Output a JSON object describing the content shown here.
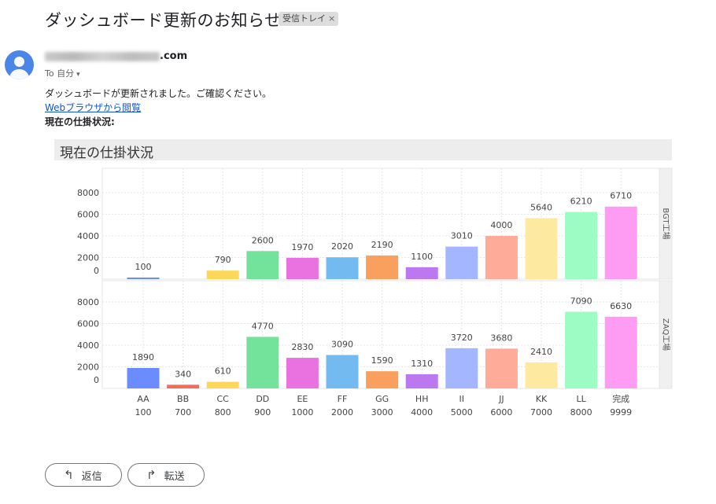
{
  "email": {
    "subject": "ダッシュボード更新のお知らせ",
    "label": "受信トレイ",
    "label_close": "×",
    "sender_domain": ".com",
    "to": "To 自分",
    "to_caret": "▾",
    "body_line1": "ダッシュボードが更新されました。ご確認ください。",
    "link_text": "Webブラウザから閲覧",
    "bold_line": "現在の仕掛状況:"
  },
  "actions": {
    "reply_label": "返信",
    "forward_label": "転送",
    "reply_icon": "↰",
    "forward_icon": "↱"
  },
  "chart_title": "現在の仕掛状況",
  "chart_data": {
    "type": "bar",
    "title": "現在の仕掛状況",
    "categories": [
      "AA",
      "BB",
      "CC",
      "DD",
      "EE",
      "FF",
      "GG",
      "HH",
      "II",
      "JJ",
      "KK",
      "LL",
      "完成"
    ],
    "category_codes": [
      "100",
      "700",
      "800",
      "900",
      "1000",
      "2000",
      "3000",
      "4000",
      "5000",
      "6000",
      "7000",
      "8000",
      "9999"
    ],
    "colors": [
      "#6b8cff",
      "#f36e5a",
      "#fdd75a",
      "#73e39b",
      "#ea72e0",
      "#73baf0",
      "#f9a05e",
      "#bc78ef",
      "#a4b6ff",
      "#ffab9a",
      "#fde9a0",
      "#9dfcc4",
      "#fe9cf3"
    ],
    "yticks": [
      0,
      2000,
      4000,
      6000,
      8000
    ],
    "ylim": [
      0,
      8000
    ],
    "facets": [
      {
        "name": "BGT工場",
        "values": [
          100,
          null,
          790,
          2600,
          1970,
          2020,
          2190,
          1100,
          3010,
          4000,
          5640,
          6210,
          6710
        ]
      },
      {
        "name": "ZAQ工場",
        "values": [
          1890,
          340,
          610,
          4770,
          2830,
          3090,
          1590,
          1310,
          3720,
          3680,
          2410,
          7090,
          6630
        ]
      }
    ]
  }
}
